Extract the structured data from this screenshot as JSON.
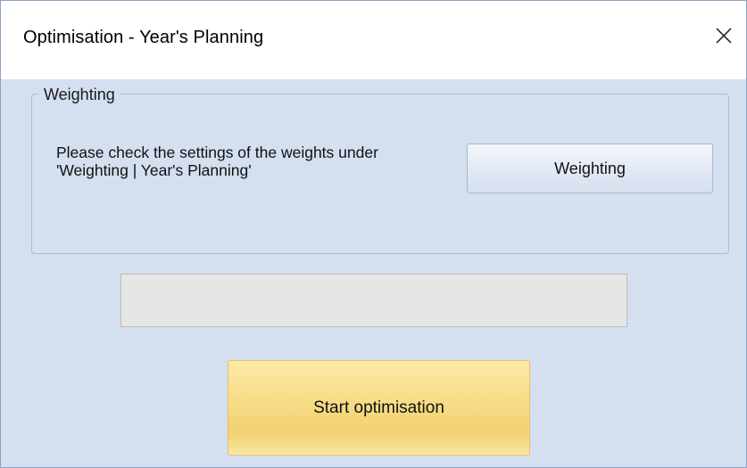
{
  "window": {
    "title": "Optimisation - Year's Planning",
    "close_icon": "close-icon"
  },
  "weighting_group": {
    "legend": "Weighting",
    "info_line_1": "Please check the settings of the weights under",
    "info_line_2": "'Weighting | Year's Planning'",
    "button_label": "Weighting"
  },
  "progress": {
    "value": 0
  },
  "actions": {
    "start_label": "Start optimisation"
  },
  "colors": {
    "dialog_background": "#d4dff0",
    "start_button": "#f6dc86",
    "progress_track": "#e6e6e6"
  }
}
